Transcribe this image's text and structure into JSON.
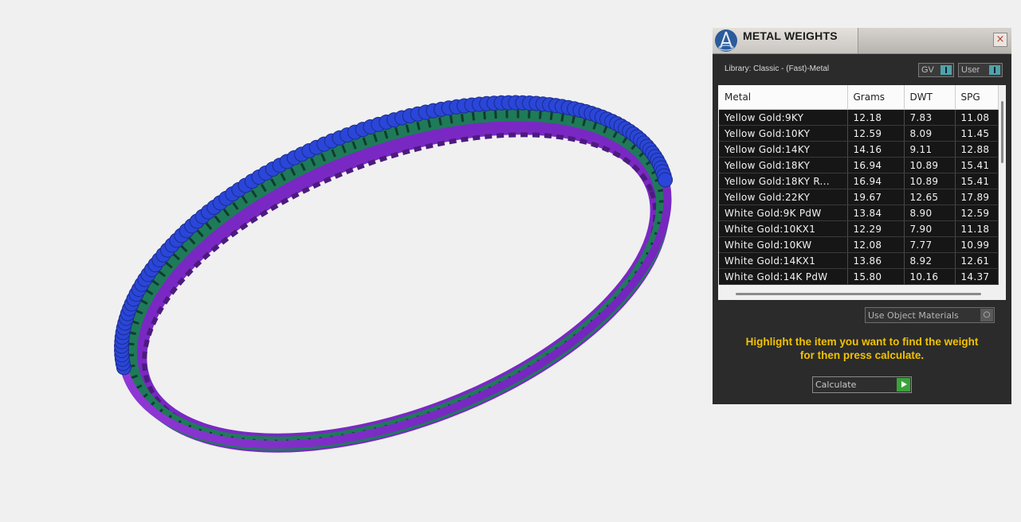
{
  "viewport": {
    "object": "eternity-band-ring",
    "colors": {
      "stones": "#2a46d8",
      "metal": "#8a2fd0",
      "settings": "#1f7a5a"
    }
  },
  "panel": {
    "title": "METAL WEIGHTS",
    "close_label": "×",
    "library_label": "Library: Classic - (Fast)-Metal",
    "toggles": [
      {
        "label": "GV"
      },
      {
        "label": "User"
      }
    ],
    "table": {
      "columns": [
        "Metal",
        "Grams",
        "DWT",
        "SPG"
      ],
      "rows": [
        [
          "Yellow Gold:9KY",
          "12.18",
          "7.83",
          "11.08"
        ],
        [
          "Yellow Gold:10KY",
          "12.59",
          "8.09",
          "11.45"
        ],
        [
          "Yellow Gold:14KY",
          "14.16",
          "9.11",
          "12.88"
        ],
        [
          "Yellow Gold:18KY",
          "16.94",
          "10.89",
          "15.41"
        ],
        [
          "Yellow Gold:18KY R...",
          "16.94",
          "10.89",
          "15.41"
        ],
        [
          "Yellow Gold:22KY",
          "19.67",
          "12.65",
          "17.89"
        ],
        [
          "White Gold:9K PdW",
          "13.84",
          "8.90",
          "12.59"
        ],
        [
          "White Gold:10KX1",
          "12.29",
          "7.90",
          "11.18"
        ],
        [
          "White Gold:10KW",
          "12.08",
          "7.77",
          "10.99"
        ],
        [
          "White Gold:14KX1",
          "13.86",
          "8.92",
          "12.61"
        ],
        [
          "White Gold:14K PdW",
          "15.80",
          "10.16",
          "14.37"
        ]
      ]
    },
    "use_object_materials": "Use Object Materials",
    "hint_line1": "Highlight the item you want to find the weight",
    "hint_line2": "for then press calculate.",
    "calculate_label": "Calculate",
    "colors": {
      "accent_yellow": "#f2c200",
      "toggle_teal": "#4fa3a9",
      "go_green": "#3aa23a"
    }
  }
}
